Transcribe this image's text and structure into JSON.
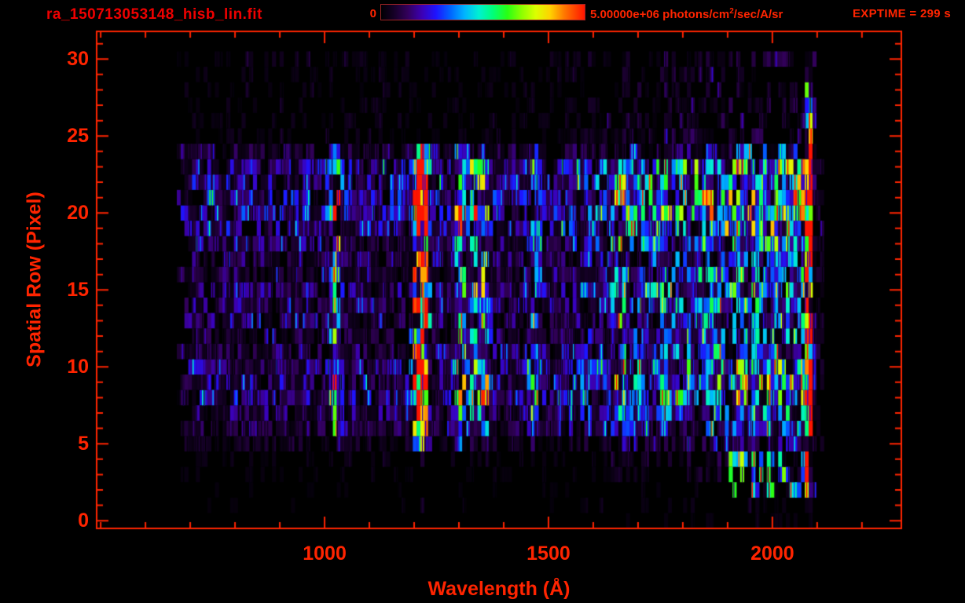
{
  "header": {
    "title": "ra_150713053148_hisb_lin.fit",
    "exptime": "EXPTIME = 299 s",
    "colorbar": {
      "min_label": "0",
      "max_value": "5.00000e+06",
      "unit_prefix": " photons/cm",
      "unit_sup": "2",
      "unit_suffix": "/sec/A/sr"
    }
  },
  "colors": {
    "background": "#000000",
    "title_red": "#ee0000",
    "axis_red": "#ff2400",
    "colorbar_border": "#a02525"
  },
  "chart_data": {
    "type": "heatmap",
    "title": "ra_150713053148_hisb_lin.fit",
    "xlabel": "Wavelength (Å)",
    "ylabel": "Spatial Row (Pixel)",
    "xlim": [
      491,
      2288
    ],
    "ylim": [
      -0.5,
      31.8
    ],
    "x_major_ticks": [
      1000,
      1500,
      2000
    ],
    "x_tick_labels": [
      "1000",
      "1500",
      "2000"
    ],
    "x_minor_step": 100,
    "x_minor_range": [
      500,
      2200
    ],
    "y_major_ticks": [
      0,
      5,
      10,
      15,
      20,
      25,
      30
    ],
    "y_tick_labels": [
      "0",
      "5",
      "10",
      "15",
      "20",
      "25",
      "30"
    ],
    "y_minor_step": 1,
    "y_minor_range": [
      0,
      31
    ],
    "grid": false,
    "legend_position": "top-colorbar",
    "colorbar_range_photons": [
      0,
      5000000
    ],
    "colormap_stops": [
      {
        "pos": 0.0,
        "color": "#000002"
      },
      {
        "pos": 0.06,
        "color": "#140024"
      },
      {
        "pos": 0.13,
        "color": "#32005a"
      },
      {
        "pos": 0.2,
        "color": "#3c00b4"
      },
      {
        "pos": 0.27,
        "color": "#1e14ff"
      },
      {
        "pos": 0.34,
        "color": "#0064ff"
      },
      {
        "pos": 0.41,
        "color": "#00b4ff"
      },
      {
        "pos": 0.48,
        "color": "#00f0d2"
      },
      {
        "pos": 0.55,
        "color": "#00ff78"
      },
      {
        "pos": 0.62,
        "color": "#28ff14"
      },
      {
        "pos": 0.69,
        "color": "#8cff00"
      },
      {
        "pos": 0.76,
        "color": "#dcff00"
      },
      {
        "pos": 0.83,
        "color": "#ffd200"
      },
      {
        "pos": 0.9,
        "color": "#ff7800"
      },
      {
        "pos": 1.0,
        "color": "#ff1400"
      }
    ],
    "data_extent": {
      "wavelength_min": 670,
      "wavelength_max": 2090,
      "overscan_max": 2120,
      "row_min": 0,
      "row_max": 30,
      "column_width_angstrom": 8.5
    },
    "row_brightness": [
      0.03,
      0.05,
      0.06,
      0.09,
      0.14,
      0.25,
      0.5,
      0.62,
      0.8,
      0.85,
      0.78,
      0.6,
      0.56,
      0.62,
      0.68,
      0.7,
      0.6,
      0.56,
      0.72,
      0.88,
      1.0,
      1.0,
      0.92,
      0.88,
      0.45,
      0.15,
      0.14,
      0.13,
      0.13,
      0.12,
      0.15
    ],
    "continuum": [
      {
        "from": 670,
        "to": 1500,
        "level_start": 0.16,
        "level_end": 0.16
      },
      {
        "from": 1500,
        "to": 1850,
        "level_start": 0.16,
        "level_end": 0.46
      },
      {
        "from": 1850,
        "to": 2090,
        "level_start": 0.46,
        "level_end": 0.5
      }
    ],
    "emission_lines": [
      {
        "wavelength": 1025,
        "amplitude": 0.62,
        "sigma": 8,
        "row_min": 5,
        "row_max": 24,
        "absolute": false
      },
      {
        "wavelength": 1216,
        "amplitude": 2.4,
        "sigma": 9,
        "row_min": 5,
        "row_max": 24,
        "absolute": false
      },
      {
        "wavelength": 1304,
        "amplitude": 0.5,
        "sigma": 8,
        "row_min": 5,
        "row_max": 24,
        "absolute": false
      },
      {
        "wavelength": 1335,
        "amplitude": 0.4,
        "sigma": 7,
        "row_min": 5,
        "row_max": 24,
        "absolute": false
      },
      {
        "wavelength": 1356,
        "amplitude": 0.5,
        "sigma": 8,
        "row_min": 5,
        "row_max": 24,
        "absolute": false
      },
      {
        "wavelength": 1470,
        "amplitude": 0.25,
        "sigma": 9,
        "row_min": 5,
        "row_max": 24,
        "absolute": false
      },
      {
        "wavelength": 1660,
        "amplitude": 0.22,
        "sigma": 9,
        "row_min": 5,
        "row_max": 24,
        "absolute": false
      },
      {
        "wavelength": 2082,
        "amplitude": 1.1,
        "sigma": 5,
        "row_min": 2,
        "row_max": 30,
        "absolute": true
      }
    ],
    "patches": [
      {
        "rows": [
          2,
          4
        ],
        "wavelength_range": [
          1900,
          2078
        ],
        "intensity": 0.5
      },
      {
        "rows": [
          0,
          4
        ],
        "wavelength_range": [
          1212,
          1222
        ],
        "intensity": 0.1
      },
      {
        "rows": [
          0,
          3
        ],
        "wavelength_range": [
          2085,
          2093
        ],
        "intensity": 0.1
      },
      {
        "rows": [
          5,
          24
        ],
        "wavelength_range": [
          2093,
          2118
        ],
        "intensity": 0.07
      }
    ]
  }
}
